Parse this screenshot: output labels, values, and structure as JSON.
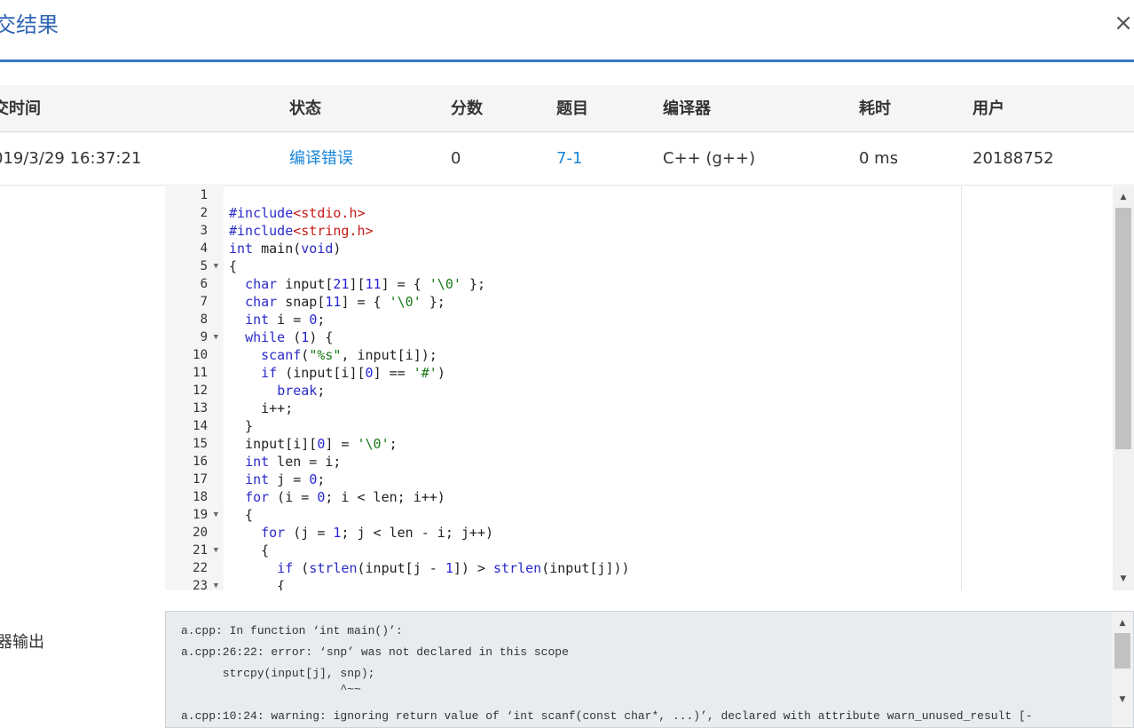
{
  "modal": {
    "title": "交结果",
    "close": "×"
  },
  "table": {
    "headers": [
      "交时间",
      "状态",
      "分数",
      "题目",
      "编译器",
      "耗时",
      "用户"
    ],
    "row": {
      "time": "019/3/29 16:37:21",
      "status": "编译错误",
      "score": "0",
      "problem": "7-1",
      "compiler": "C++ (g++)",
      "elapsed": "0 ms",
      "user": "20188752"
    }
  },
  "code": {
    "lines": [
      "",
      "#include<stdio.h>",
      "#include<string.h>",
      "int main(void)",
      "{",
      "  char input[21][11] = { '\\0' };",
      "  char snap[11] = { '\\0' };",
      "  int i = 0;",
      "  while (1) {",
      "    scanf(\"%s\", input[i]);",
      "    if (input[i][0] == '#')",
      "      break;",
      "    i++;",
      "  }",
      "  input[i][0] = '\\0';",
      "  int len = i;",
      "  int j = 0;",
      "  for (i = 0; i < len; i++)",
      "  {",
      "    for (j = 1; j < len - i; j++)",
      "    {",
      "      if (strlen(input[j - 1]) > strlen(input[j]))",
      "      {"
    ],
    "fold_lines": [
      5,
      9,
      19,
      21,
      23
    ]
  },
  "compiler_output": {
    "label": "器输出",
    "lines": [
      "a.cpp: In function ‘int main()’:",
      "a.cpp:26:22: error: ‘snp’ was not declared in this scope",
      "      strcpy(input[j], snp);",
      "                       ^~~",
      "a.cpp:10:24: warning: ignoring return value of ‘int scanf(const char*, ...)’, declared with attribute warn_unused_result [-"
    ]
  }
}
